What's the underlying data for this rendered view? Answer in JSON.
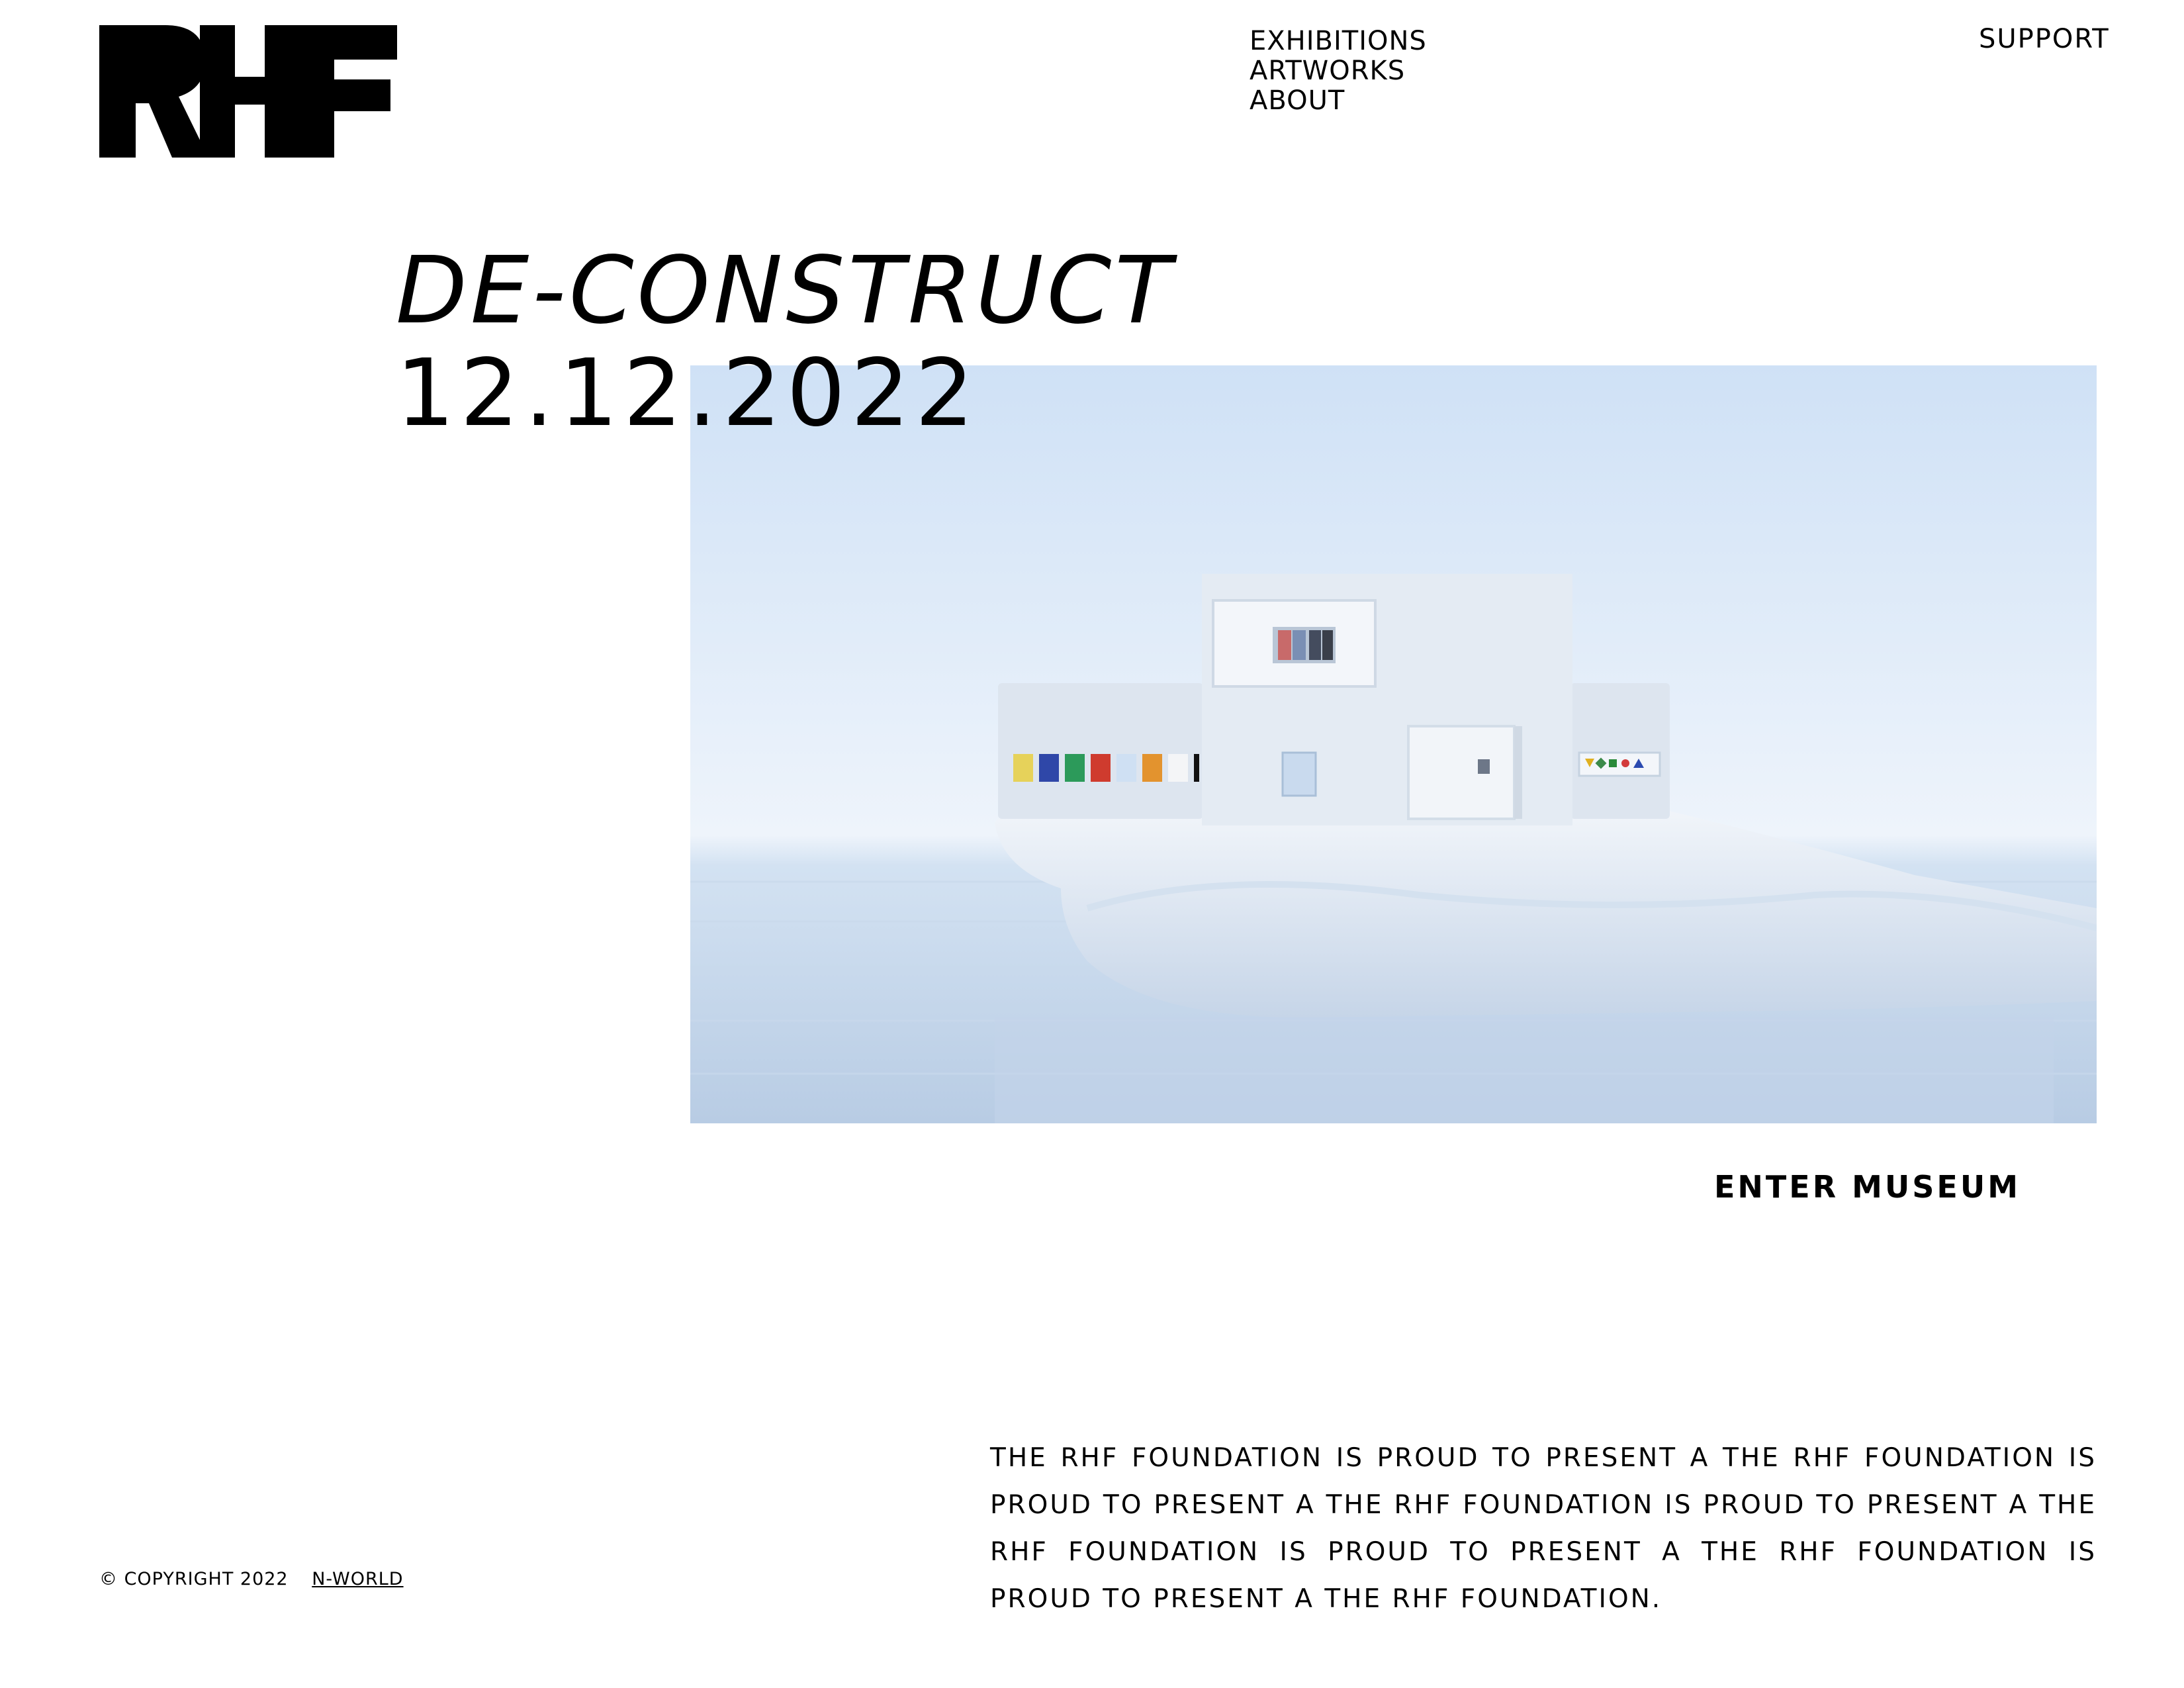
{
  "brand": {
    "logo_text": "RHF",
    "logo_color": "#000000"
  },
  "nav": {
    "items": [
      {
        "label": "EXHIBITIONS"
      },
      {
        "label": "ARTWORKS"
      },
      {
        "label": "ABOUT"
      }
    ],
    "support_label": "SUPPORT"
  },
  "exhibition": {
    "title": "DE-CONSTRUCT",
    "date": "12.12.2022",
    "image_alt": "Virtual museum building on an ice floe in calm water",
    "enter_label": "ENTER MUSEUM"
  },
  "description": {
    "text": "THE RHF FOUNDATION IS PROUD TO PRESENT A THE RHF FOUNDATION IS PROUD TO PRESENT A THE RHF FOUNDATION IS PROUD TO PRESENT A THE RHF FOUNDATION IS PROUD TO PRESENT A THE RHF FOUNDATION IS PROUD TO PRESENT A THE RHF FOUNDATION."
  },
  "footer": {
    "copyright": "© COPYRIGHT 2022",
    "credit_link": "N-WORLD"
  },
  "colors": {
    "background": "#ffffff",
    "text": "#000000",
    "sky": "#d6e6f7",
    "water": "#bcd0e8"
  }
}
